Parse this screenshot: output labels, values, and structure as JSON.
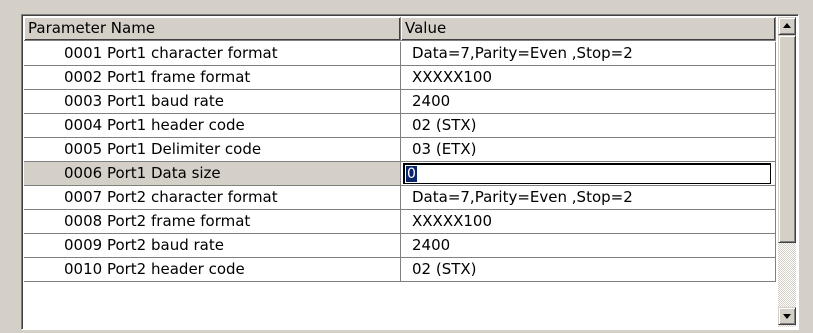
{
  "grid": {
    "columns": [
      "Parameter Name",
      "Value"
    ],
    "rows": [
      {
        "name": "0001 Port1 character format",
        "value": "Data=7,Parity=Even ,Stop=2"
      },
      {
        "name": "0002 Port1 frame format",
        "value": "XXXXX100"
      },
      {
        "name": "0003 Port1 baud rate",
        "value": "2400"
      },
      {
        "name": "0004 Port1 header code",
        "value": "02 (STX)"
      },
      {
        "name": "0005 Port1 Delimiter code",
        "value": "03 (ETX)"
      },
      {
        "name": "0006 Port1 Data size",
        "value": "0"
      },
      {
        "name": "0007 Port2 character format",
        "value": "Data=7,Parity=Even ,Stop=2"
      },
      {
        "name": "0008 Port2 frame format",
        "value": "XXXXX100"
      },
      {
        "name": "0009 Port2 baud rate",
        "value": "2400"
      },
      {
        "name": "0010 Port2 header code",
        "value": "02 (STX)"
      }
    ],
    "selected_row": 5
  },
  "scrollbar": {
    "up_icon": "arrow-up-icon",
    "down_icon": "arrow-down-icon"
  },
  "colors": {
    "selection": "#0a246a",
    "face": "#d4d0c8"
  }
}
